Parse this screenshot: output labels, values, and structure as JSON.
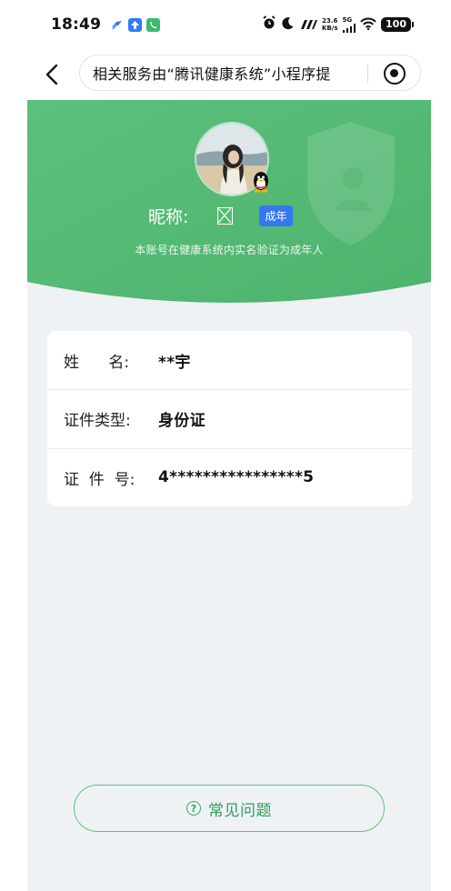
{
  "status_bar": {
    "time": "18:49",
    "net_speed_value": "23.6",
    "net_speed_unit": "KB/s",
    "network_type": "5G",
    "battery": "100"
  },
  "nav": {
    "title": "相关服务由“腾讯健康系统”小程序提"
  },
  "profile": {
    "nickname_label": "昵称:",
    "adult_badge": "成年",
    "verify_text": "本账号在健康系统内实名验证为成年人"
  },
  "info_rows": [
    {
      "label": "姓      名:",
      "value": "**宇"
    },
    {
      "label": "证件类型:",
      "value": "身份证"
    },
    {
      "label": "证  件  号:",
      "value": "4****************5"
    }
  ],
  "faq": {
    "label": "常见问题",
    "icon": "question-circle-icon"
  },
  "colors": {
    "hero_green": "#5cbf7a",
    "accent_blue": "#3478f0",
    "faq_green": "#2f9c59",
    "page_bg": "#eff2f5"
  }
}
